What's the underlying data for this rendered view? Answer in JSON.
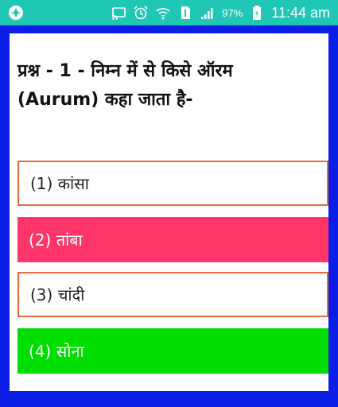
{
  "status_bar": {
    "battery_percent": "97%",
    "time": "11:44 am",
    "icons": [
      "app-icon",
      "cast-icon",
      "alarm-icon",
      "wifi-icon",
      "sim-icon",
      "signal-icon",
      "battery-icon"
    ]
  },
  "question": {
    "text": "प्रश्न - 1 - निम्न में से किसे ऑरम (Aurum) कहा जाता है-"
  },
  "options": [
    {
      "label": "(1) कांसा",
      "state": "default"
    },
    {
      "label": "(2) तांबा",
      "state": "wrong"
    },
    {
      "label": "(3) चांदी",
      "state": "default"
    },
    {
      "label": "(4) सोना",
      "state": "correct"
    }
  ],
  "colors": {
    "status_bar": "#21c7b5",
    "frame": "#0a1ee6",
    "option_border": "#e86a3a",
    "wrong": "#ff3468",
    "correct": "#00dd00"
  }
}
